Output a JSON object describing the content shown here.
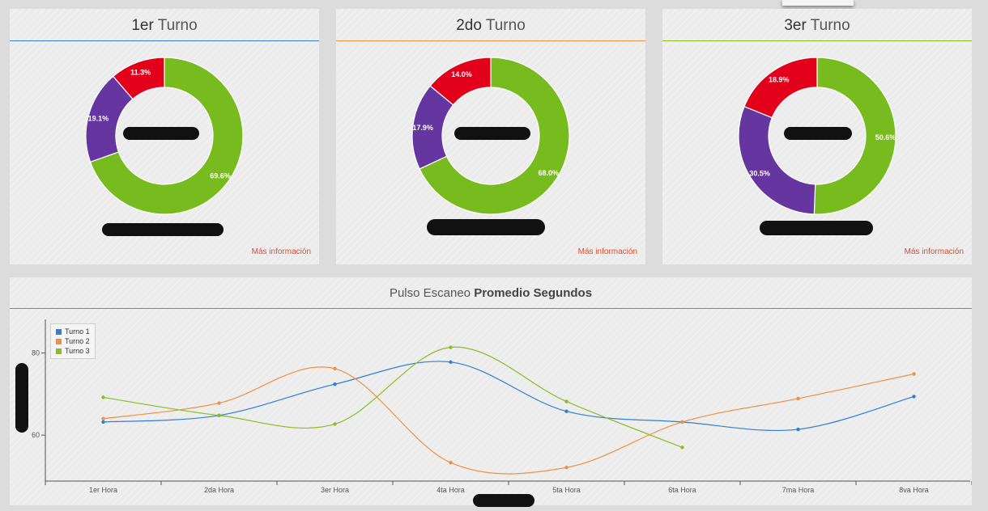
{
  "panels": [
    {
      "id": "p1",
      "title_strong": "1er",
      "title_rest": "Turno",
      "accent": "#2f7ed8",
      "more": "Más información"
    },
    {
      "id": "p2",
      "title_strong": "2do",
      "title_rest": "Turno",
      "accent": "#f28f43",
      "more": "Más información"
    },
    {
      "id": "p3",
      "title_strong": "3er",
      "title_rest": "Turno",
      "accent": "#8bbc21",
      "more": "Más información"
    }
  ],
  "line_chart": {
    "title_light": "Pulso Escaneo",
    "title_bold": "Promedio Segundos"
  },
  "colors": {
    "green": "#78bb1e",
    "purple": "#6535a0",
    "red": "#e3001b",
    "blue": "#2f7ed8",
    "orange": "#f28f43",
    "lime": "#8bbc21"
  },
  "chart_data": [
    {
      "type": "pie",
      "title": "1er Turno",
      "slices": [
        {
          "label": "69.6%",
          "value": 69.6,
          "color": "#78bb1e"
        },
        {
          "label": "19.1%",
          "value": 19.1,
          "color": "#6535a0"
        },
        {
          "label": "11.3%",
          "value": 11.3,
          "color": "#e3001b"
        }
      ]
    },
    {
      "type": "pie",
      "title": "2do Turno",
      "slices": [
        {
          "label": "68.0%",
          "value": 68.0,
          "color": "#78bb1e"
        },
        {
          "label": "17.9%",
          "value": 17.9,
          "color": "#6535a0"
        },
        {
          "label": "14.0%",
          "value": 14.0,
          "color": "#e3001b"
        }
      ]
    },
    {
      "type": "pie",
      "title": "3er Turno",
      "slices": [
        {
          "label": "50.6%",
          "value": 50.6,
          "color": "#78bb1e"
        },
        {
          "label": "30.5%",
          "value": 30.5,
          "color": "#6535a0"
        },
        {
          "label": "18.9%",
          "value": 18.9,
          "color": "#e3001b"
        }
      ]
    },
    {
      "type": "line",
      "title": "Pulso Escaneo Promedio Segundos",
      "categories": [
        "1er Hora",
        "2da Hora",
        "3er Hora",
        "4ta Hora",
        "5ta Hora",
        "6ta Hora",
        "7ma Hora",
        "8va Hora"
      ],
      "yticks": [
        60,
        80
      ],
      "ylim": [
        48.8,
        88.2
      ],
      "legend_position": "top-left",
      "series": [
        {
          "name": "Turno 1",
          "color": "#2f7ed8",
          "values": [
            63.2,
            64.8,
            72.4,
            77.8,
            65.8,
            63.2,
            61.4,
            69.4
          ]
        },
        {
          "name": "Turno 2",
          "color": "#f28f43",
          "values": [
            64.0,
            67.8,
            76.2,
            53.3,
            52.1,
            63.2,
            68.9,
            74.9
          ]
        },
        {
          "name": "Turno 3",
          "color": "#8bbc21",
          "values": [
            69.2,
            64.8,
            62.7,
            81.4,
            68.2,
            57.0,
            null,
            null
          ]
        }
      ]
    }
  ]
}
